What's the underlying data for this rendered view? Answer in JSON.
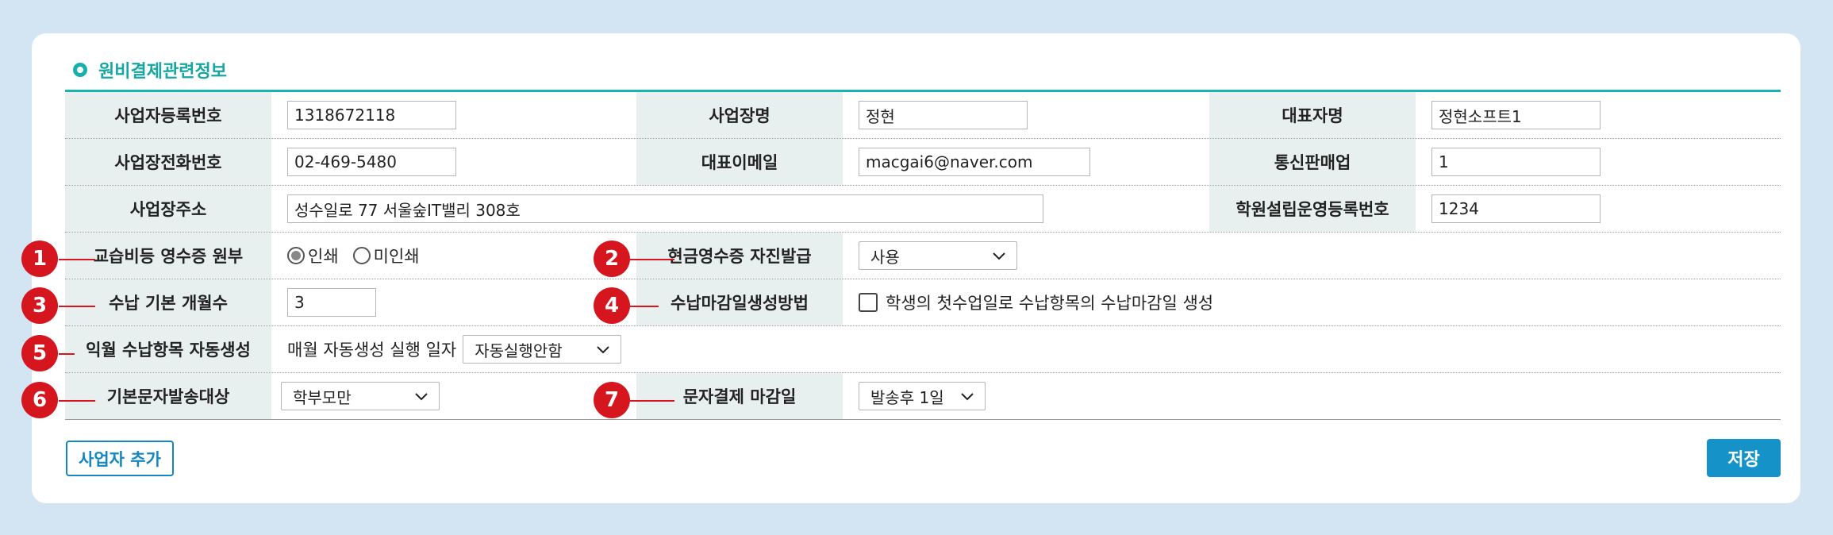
{
  "section": {
    "title": "원비결제관련정보"
  },
  "rows": {
    "biz_no": {
      "label": "사업자등록번호",
      "value": "1318672118"
    },
    "biz_name": {
      "label": "사업장명",
      "value": "정현"
    },
    "rep_name": {
      "label": "대표자명",
      "value": "정현소프트1"
    },
    "biz_phone": {
      "label": "사업장전화번호",
      "value": "02-469-5480"
    },
    "rep_email": {
      "label": "대표이메일",
      "value": "macgai6@naver.com"
    },
    "ecommerce": {
      "label": "통신판매업",
      "value": "1"
    },
    "biz_addr": {
      "label": "사업장주소",
      "value": "성수일로 77 서울숲IT밸리 308호"
    },
    "academy_no": {
      "label": "학원설립운영등록번호",
      "value": "1234"
    },
    "receipt_orig": {
      "label": "교습비등 영수증 원부",
      "options": [
        "인쇄",
        "미인쇄"
      ],
      "selected": "인쇄"
    },
    "cash_receipt": {
      "label": "현금영수증 자진발급",
      "value": "사용"
    },
    "months": {
      "label": "수납 기본 개월수",
      "value": "3"
    },
    "due_method": {
      "label": "수납마감일생성방법",
      "checkbox_label": "학생의 첫수업일로 수납항목의 수납마감일 생성",
      "checked": false
    },
    "auto_gen": {
      "label": "익월 수납항목 자동생성",
      "prefix": "매월 자동생성 실행 일자",
      "value": "자동실행안함"
    },
    "sms_target": {
      "label": "기본문자발송대상",
      "value": "학부모만"
    },
    "sms_deadline": {
      "label": "문자결제 마감일",
      "value": "발송후 1일"
    }
  },
  "badges": [
    "1",
    "2",
    "3",
    "4",
    "5",
    "6",
    "7"
  ],
  "buttons": {
    "add_biz": "사업자 추가",
    "save": "저장"
  },
  "colors": {
    "accent": "#1ab4b0",
    "badge": "#d6161f",
    "primary": "#1593c9",
    "page_bg": "#d3e4f2"
  }
}
